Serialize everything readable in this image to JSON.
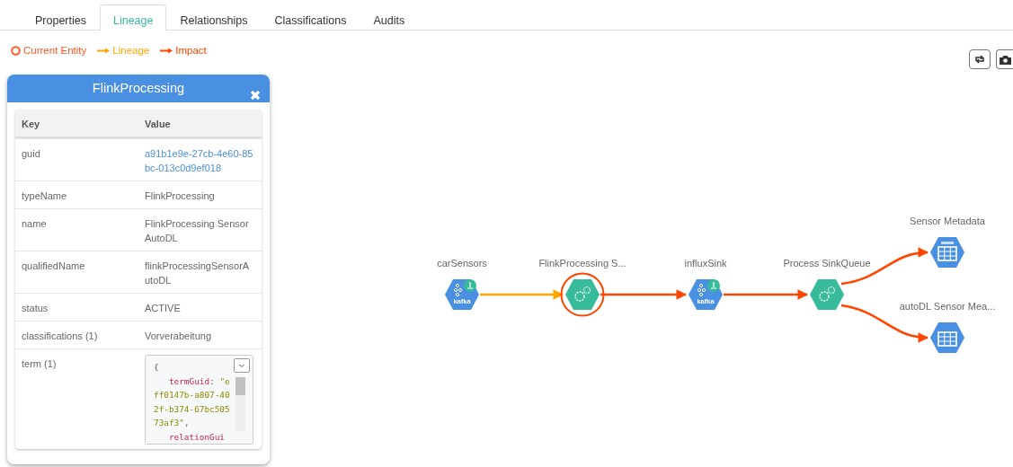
{
  "tabs": [
    {
      "label": "Properties",
      "selected": false
    },
    {
      "label": "Lineage",
      "selected": true
    },
    {
      "label": "Relationships",
      "selected": false
    },
    {
      "label": "Classifications",
      "selected": false
    },
    {
      "label": "Audits",
      "selected": false
    }
  ],
  "legend": [
    {
      "kind": "ring",
      "label": "Current Entity",
      "color": "#ff5722"
    },
    {
      "kind": "arrow",
      "label": "Lineage",
      "color": "#ffa500"
    },
    {
      "kind": "arrow",
      "label": "Impact",
      "color": "#ff4500"
    }
  ],
  "panel": {
    "title": "FlinkProcessing",
    "columns": [
      "Key",
      "Value"
    ],
    "rows": [
      {
        "key": "guid",
        "kind": "link",
        "value": "a91b1e9e-27cb-4e60-85bc-013c0d9ef018"
      },
      {
        "key": "typeName",
        "kind": "text",
        "value": "FlinkProcessing"
      },
      {
        "key": "name",
        "kind": "text",
        "value": "FlinkProcessing Sensor AutoDL"
      },
      {
        "key": "qualifiedName",
        "kind": "text",
        "value": "flinkProcessingSensorAutoDL"
      },
      {
        "key": "status",
        "kind": "text",
        "value": "ACTIVE"
      },
      {
        "key": "classifications (1)",
        "kind": "text",
        "value": "Vorverabeitung"
      },
      {
        "key": "term (1)",
        "kind": "code",
        "lines": [
          [
            {
              "kind": "punct",
              "s": "{"
            }
          ],
          [
            {
              "kind": "key",
              "s": "   termGuid"
            },
            {
              "kind": "punct",
              "s": ": "
            },
            {
              "kind": "string",
              "s": "\"e"
            }
          ],
          [
            {
              "kind": "string",
              "s": "ff0147b-a807-40"
            }
          ],
          [
            {
              "kind": "string",
              "s": "2f-b374-67bc505"
            }
          ],
          [
            {
              "kind": "string",
              "s": "73af3\""
            },
            {
              "kind": "punct",
              "s": ","
            }
          ],
          [
            {
              "kind": "key",
              "s": "   relationGui"
            }
          ]
        ]
      }
    ]
  },
  "graph": {
    "nodes": [
      {
        "label": "carSensors",
        "kind": "kafka",
        "icon_text": "kafka",
        "current": false
      },
      {
        "label": "FlinkProcessing S...",
        "kind": "process",
        "current": true
      },
      {
        "label": "influxSink",
        "kind": "kafka",
        "icon_text": "kafka",
        "current": false
      },
      {
        "label": "Process SinkQueue",
        "kind": "process",
        "current": false
      },
      {
        "label": "Sensor Metadata",
        "kind": "table",
        "current": false
      },
      {
        "label": "autoDL Sensor Mea...",
        "kind": "table",
        "current": false
      }
    ],
    "edges": [
      {
        "kind": "lineage"
      },
      {
        "kind": "impact"
      },
      {
        "kind": "impact"
      },
      {
        "kind": "impact"
      },
      {
        "kind": "impact"
      }
    ]
  }
}
